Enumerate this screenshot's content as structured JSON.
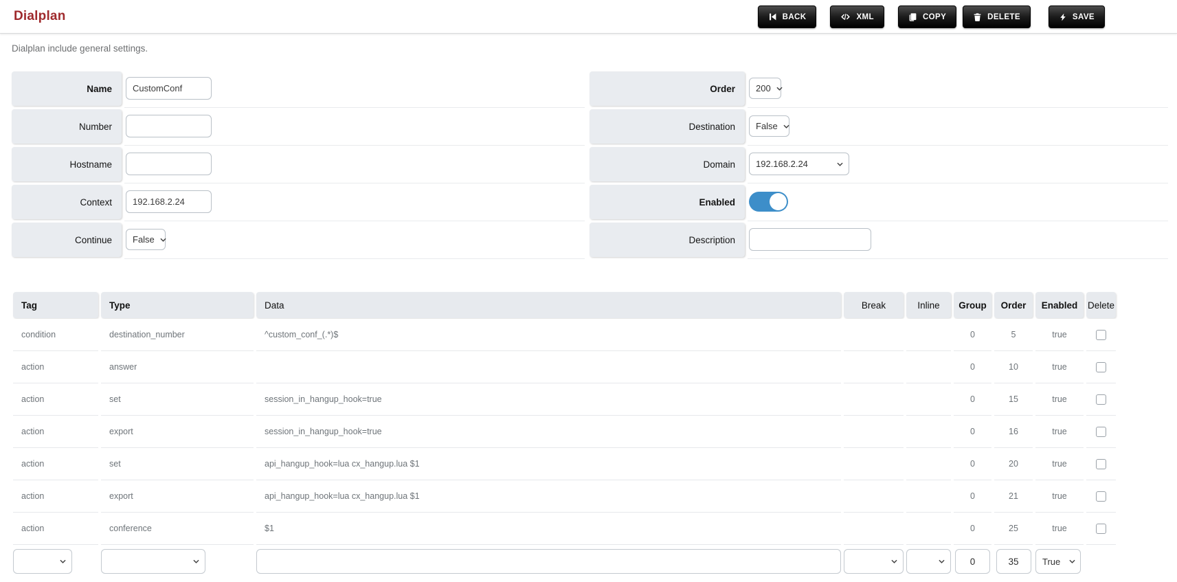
{
  "header": {
    "title": "Dialplan",
    "buttons": [
      {
        "label": "BACK",
        "icon": "skip-back-icon"
      },
      {
        "label": "XML",
        "icon": "code-icon"
      },
      {
        "label": "COPY",
        "icon": "copy-icon"
      },
      {
        "label": "DELETE",
        "icon": "trash-icon"
      },
      {
        "label": "SAVE",
        "icon": "lightning-icon"
      }
    ]
  },
  "subtitle": "Dialplan include general settings.",
  "form": {
    "name": {
      "label": "Name",
      "value": "CustomConf"
    },
    "number": {
      "label": "Number",
      "value": ""
    },
    "hostname": {
      "label": "Hostname",
      "value": ""
    },
    "context": {
      "label": "Context",
      "value": "192.168.2.24"
    },
    "continue": {
      "label": "Continue",
      "value": "False"
    },
    "order": {
      "label": "Order",
      "value": "200"
    },
    "destination": {
      "label": "Destination",
      "value": "False"
    },
    "domain": {
      "label": "Domain",
      "value": "192.168.2.24"
    },
    "enabled": {
      "label": "Enabled",
      "state": "on"
    },
    "description": {
      "label": "Description",
      "value": ""
    }
  },
  "table": {
    "columns": [
      {
        "label": "Tag"
      },
      {
        "label": "Type"
      },
      {
        "label": "Data"
      },
      {
        "label": "Break"
      },
      {
        "label": "Inline"
      },
      {
        "label": "Group"
      },
      {
        "label": "Order"
      },
      {
        "label": "Enabled"
      },
      {
        "label": "Delete"
      }
    ],
    "rows": [
      {
        "tag": "condition",
        "type": "destination_number",
        "data": "^custom_conf_(.*)$",
        "break": "",
        "inline": "",
        "group": "0",
        "order": "5",
        "enabled": "true"
      },
      {
        "tag": "action",
        "type": "answer",
        "data": "",
        "break": "",
        "inline": "",
        "group": "0",
        "order": "10",
        "enabled": "true"
      },
      {
        "tag": "action",
        "type": "set",
        "data": "session_in_hangup_hook=true",
        "break": "",
        "inline": "",
        "group": "0",
        "order": "15",
        "enabled": "true"
      },
      {
        "tag": "action",
        "type": "export",
        "data": "session_in_hangup_hook=true",
        "break": "",
        "inline": "",
        "group": "0",
        "order": "16",
        "enabled": "true"
      },
      {
        "tag": "action",
        "type": "set",
        "data": "api_hangup_hook=lua cx_hangup.lua $1",
        "break": "",
        "inline": "",
        "group": "0",
        "order": "20",
        "enabled": "true"
      },
      {
        "tag": "action",
        "type": "export",
        "data": "api_hangup_hook=lua cx_hangup.lua $1",
        "break": "",
        "inline": "",
        "group": "0",
        "order": "21",
        "enabled": "true"
      },
      {
        "tag": "action",
        "type": "conference",
        "data": "$1",
        "break": "",
        "inline": "",
        "group": "0",
        "order": "25",
        "enabled": "true"
      }
    ],
    "new_row": {
      "tag": "",
      "type": "",
      "data": "",
      "break": "",
      "inline": "",
      "group": "0",
      "order": "35",
      "enabled": "True"
    }
  },
  "colors": {
    "title": "#9f2a2d",
    "button_bg": "#1d1d1d",
    "toggle_on": "#3d8ec9",
    "label_cell_bg": "#e9ecf0",
    "header_cell_bg": "#e7eaee"
  }
}
